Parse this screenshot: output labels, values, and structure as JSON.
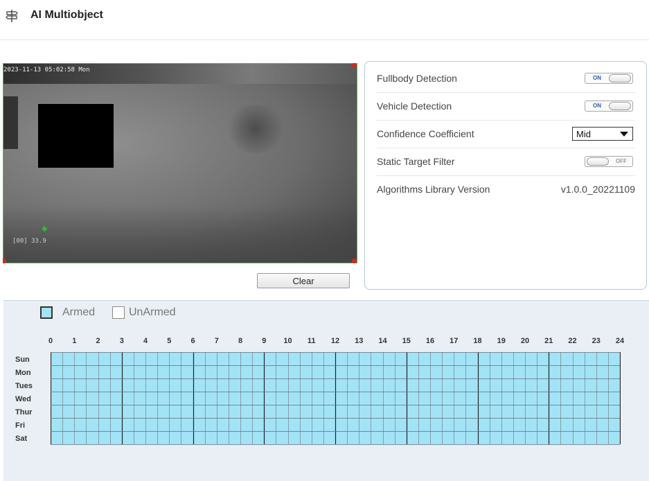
{
  "header": {
    "title": "AI Multiobject",
    "icon": "signpost-icon"
  },
  "video": {
    "timestamp": "2023-11-13 05:02:58 Mon",
    "osd_text": "[00] 33.9",
    "marker_icon": "target-marker-icon"
  },
  "clear_button": {
    "label": "Clear"
  },
  "settings": {
    "fullbody": {
      "label": "Fullbody Detection",
      "state": "ON"
    },
    "vehicle": {
      "label": "Vehicle Detection",
      "state": "ON"
    },
    "confidence": {
      "label": "Confidence Coefficient",
      "value": "Mid"
    },
    "static_filter": {
      "label": "Static Target Filter",
      "state": "OFF"
    },
    "algorithms": {
      "label": "Algorithms Library Version",
      "value": "v1.0.0_20221109"
    }
  },
  "schedule": {
    "legend": {
      "armed": "Armed",
      "unarmed": "UnArmed"
    },
    "hours": [
      "0",
      "1",
      "2",
      "3",
      "4",
      "5",
      "6",
      "7",
      "8",
      "9",
      "10",
      "11",
      "12",
      "13",
      "14",
      "15",
      "16",
      "17",
      "18",
      "19",
      "20",
      "21",
      "22",
      "23",
      "24"
    ],
    "days": [
      "Sun",
      "Mon",
      "Tues",
      "Wed",
      "Thur",
      "Fri",
      "Sat"
    ],
    "all_armed": true,
    "armed_color": "#a3e3f6"
  }
}
